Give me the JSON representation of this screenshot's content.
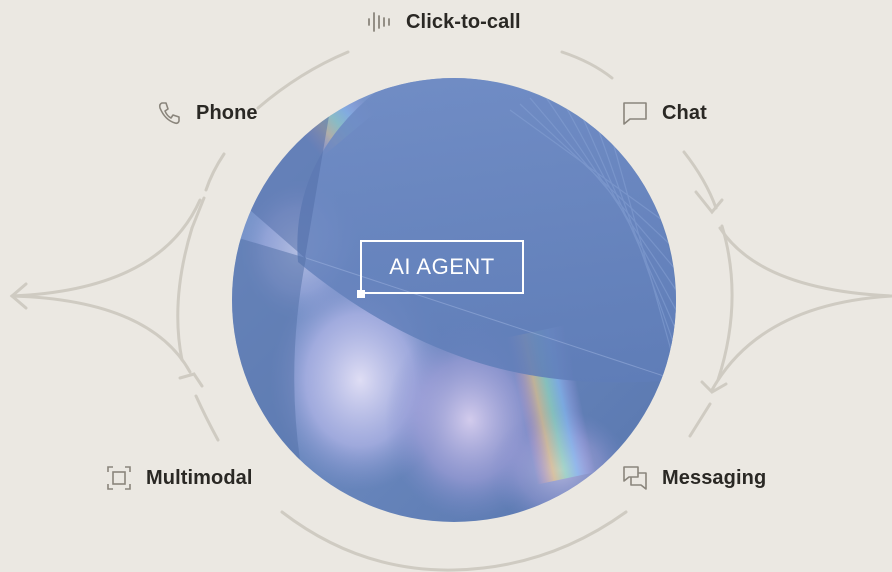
{
  "center": {
    "label": "AI AGENT"
  },
  "channels": {
    "click_to_call": {
      "label": "Click-to-call",
      "icon": "waveform-icon"
    },
    "phone": {
      "label": "Phone",
      "icon": "phone-icon"
    },
    "chat": {
      "label": "Chat",
      "icon": "chat-bubble-icon"
    },
    "multimodal": {
      "label": "Multimodal",
      "icon": "frame-icon"
    },
    "messaging": {
      "label": "Messaging",
      "icon": "messages-icon"
    }
  },
  "colors": {
    "background": "#ebe8e2",
    "ring": "#cfcbc2",
    "text": "#2a2824",
    "orb_primary": "#6a88be",
    "orb_highlight": "#c7cff0"
  }
}
